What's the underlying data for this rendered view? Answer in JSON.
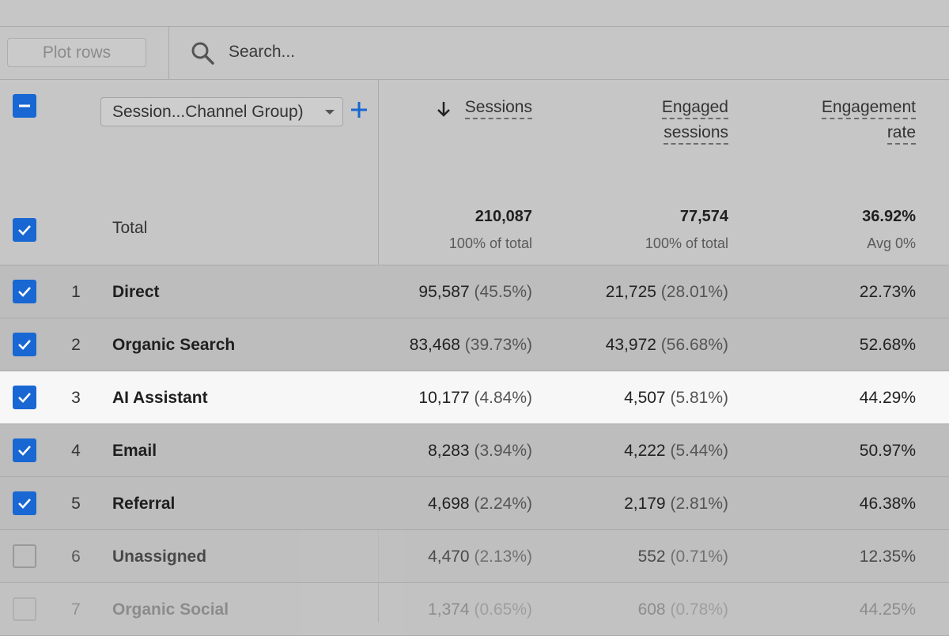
{
  "toolbar": {
    "plot_rows_label": "Plot rows",
    "search_placeholder": "Search..."
  },
  "dimension": {
    "label": "Session...Channel Group)"
  },
  "columns": [
    {
      "label_line1": "Sessions",
      "label_line2": "",
      "sorted": "descending"
    },
    {
      "label_line1": "Engaged",
      "label_line2": "sessions"
    },
    {
      "label_line1": "Engagement",
      "label_line2": "rate"
    }
  ],
  "total": {
    "label": "Total",
    "sessions": "210,087",
    "sessions_sub": "100% of total",
    "engaged": "77,574",
    "engaged_sub": "100% of total",
    "rate": "36.92%",
    "rate_sub": "Avg 0%"
  },
  "rows": [
    {
      "num": "1",
      "name": "Direct",
      "sessions": "95,587",
      "sessions_pct": "(45.5%)",
      "engaged": "21,725",
      "engaged_pct": "(28.01%)",
      "rate": "22.73%",
      "checked": true
    },
    {
      "num": "2",
      "name": "Organic Search",
      "sessions": "83,468",
      "sessions_pct": "(39.73%)",
      "engaged": "43,972",
      "engaged_pct": "(56.68%)",
      "rate": "52.68%",
      "checked": true
    },
    {
      "num": "3",
      "name": "AI Assistant",
      "sessions": "10,177",
      "sessions_pct": "(4.84%)",
      "engaged": "4,507",
      "engaged_pct": "(5.81%)",
      "rate": "44.29%",
      "checked": true
    },
    {
      "num": "4",
      "name": "Email",
      "sessions": "8,283",
      "sessions_pct": "(3.94%)",
      "engaged": "4,222",
      "engaged_pct": "(5.44%)",
      "rate": "50.97%",
      "checked": true
    },
    {
      "num": "5",
      "name": "Referral",
      "sessions": "4,698",
      "sessions_pct": "(2.24%)",
      "engaged": "2,179",
      "engaged_pct": "(2.81%)",
      "rate": "46.38%",
      "checked": true
    },
    {
      "num": "6",
      "name": "Unassigned",
      "sessions": "4,470",
      "sessions_pct": "(2.13%)",
      "engaged": "552",
      "engaged_pct": "(0.71%)",
      "rate": "12.35%",
      "checked": false
    },
    {
      "num": "7",
      "name": "Organic Social",
      "sessions": "1,374",
      "sessions_pct": "(0.65%)",
      "engaged": "608",
      "engaged_pct": "(0.78%)",
      "rate": "44.25%",
      "checked": false
    }
  ],
  "colors": {
    "accent": "#1967d2",
    "highlight_row": "#f7f7f7",
    "overlay_bg": "#c6c6c6"
  }
}
